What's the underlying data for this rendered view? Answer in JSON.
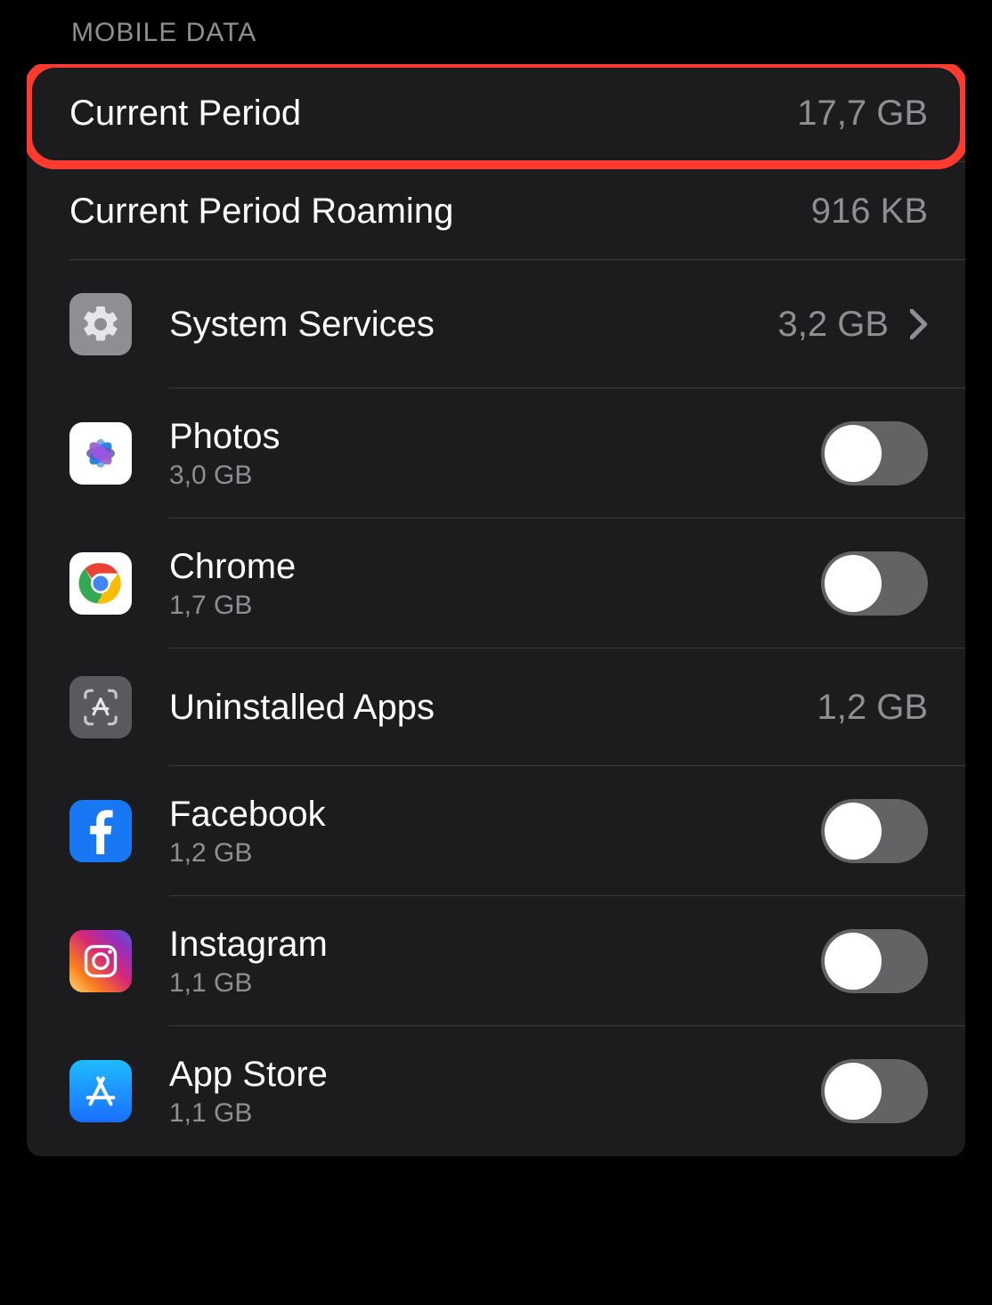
{
  "section_header": "MOBILE DATA",
  "rows": {
    "current_period": {
      "label": "Current Period",
      "value": "17,7 GB"
    },
    "current_roaming": {
      "label": "Current Period Roaming",
      "value": "916 KB"
    },
    "system_services": {
      "label": "System Services",
      "value": "3,2 GB"
    },
    "photos": {
      "label": "Photos",
      "usage": "3,0 GB",
      "toggle": false
    },
    "chrome": {
      "label": "Chrome",
      "usage": "1,7 GB",
      "toggle": false
    },
    "uninstalled": {
      "label": "Uninstalled Apps",
      "value": "1,2 GB"
    },
    "facebook": {
      "label": "Facebook",
      "usage": "1,2 GB",
      "toggle": false
    },
    "instagram": {
      "label": "Instagram",
      "usage": "1,1 GB",
      "toggle": false
    },
    "appstore": {
      "label": "App Store",
      "usage": "1,1 GB",
      "toggle": false
    }
  },
  "icons": {
    "settings": "gear-icon",
    "photos": "photos-icon",
    "chrome": "chrome-icon",
    "uninstalled": "uninstalled-apps-icon",
    "facebook": "facebook-icon",
    "instagram": "instagram-icon",
    "appstore": "app-store-icon",
    "chevron": "chevron-right-icon"
  },
  "highlight_color": "#ff3b30"
}
